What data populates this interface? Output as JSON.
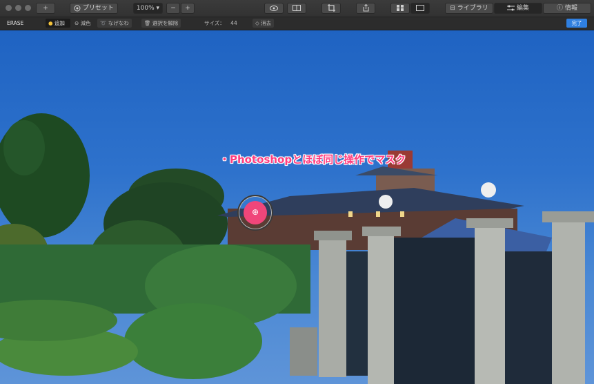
{
  "toolbar": {
    "add_icon": "plus-icon",
    "preset_label": "プリセット",
    "zoom_value": "100%",
    "zoom_out": "−",
    "zoom_in": "+",
    "library_label": "ライブラリ",
    "edit_label": "編集",
    "info_label": "情報"
  },
  "subbar": {
    "mode": "ERASE",
    "add_label": "追加",
    "subtract_label": "減色",
    "smooth_label": "なげなわ",
    "deselect_label": "選択を解除",
    "size_label": "サイズ：",
    "size_value": "44",
    "erase_label": "消去",
    "done_label": "完了"
  },
  "canvas": {
    "caption": "・Photoshopとほぼ同じ操作でマスク"
  }
}
